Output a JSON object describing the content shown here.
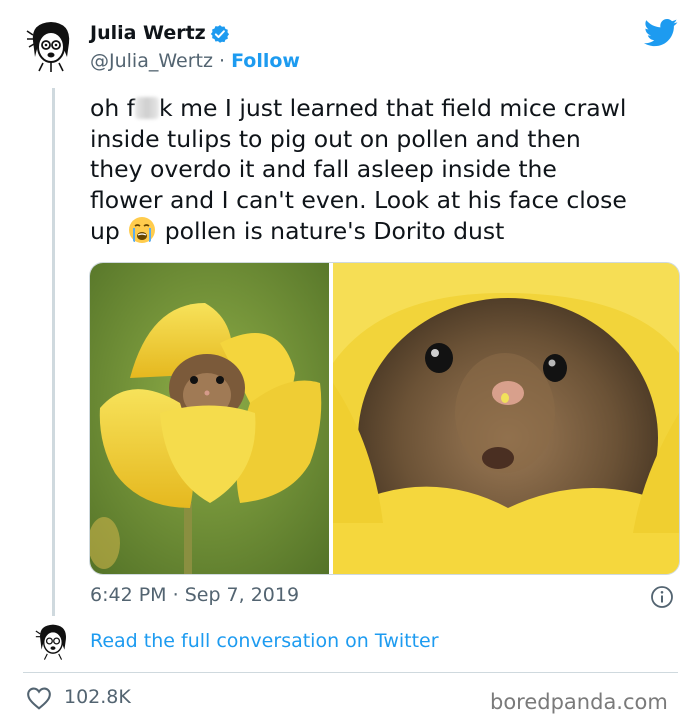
{
  "author": {
    "name": "Julia Wertz",
    "handle": "@Julia_Wertz",
    "separator": " · ",
    "follow_label": "Follow",
    "verified": true
  },
  "tweet": {
    "line1_start": "oh f",
    "line1_end": "k me I just learned that field mice crawl",
    "line2": "inside tulips to pig out on pollen and then",
    "line3": "they overdo it and fall asleep inside the",
    "line4": "flower and I can't even. Look at his face close",
    "line5_start": "up ",
    "line5_end": " pollen is nature's Dorito dust",
    "emoji": "crying-face"
  },
  "meta": {
    "time": "6:42 PM",
    "separator": " · ",
    "date": "Sep 7, 2019"
  },
  "conversation_link": "Read the full conversation on Twitter",
  "engagement": {
    "likes": "102.8K"
  },
  "watermark": "boredpanda.com",
  "colors": {
    "twitter_blue": "#1d9bf0",
    "text": "#0f1419",
    "muted": "#536471",
    "border": "#cfd9de",
    "tulip_yellow": "#f2d43a",
    "background_green": "#6f8f3a"
  },
  "icons": [
    "twitter-bird-icon",
    "verified-badge-icon",
    "info-icon",
    "heart-icon",
    "crying-face-emoji"
  ]
}
